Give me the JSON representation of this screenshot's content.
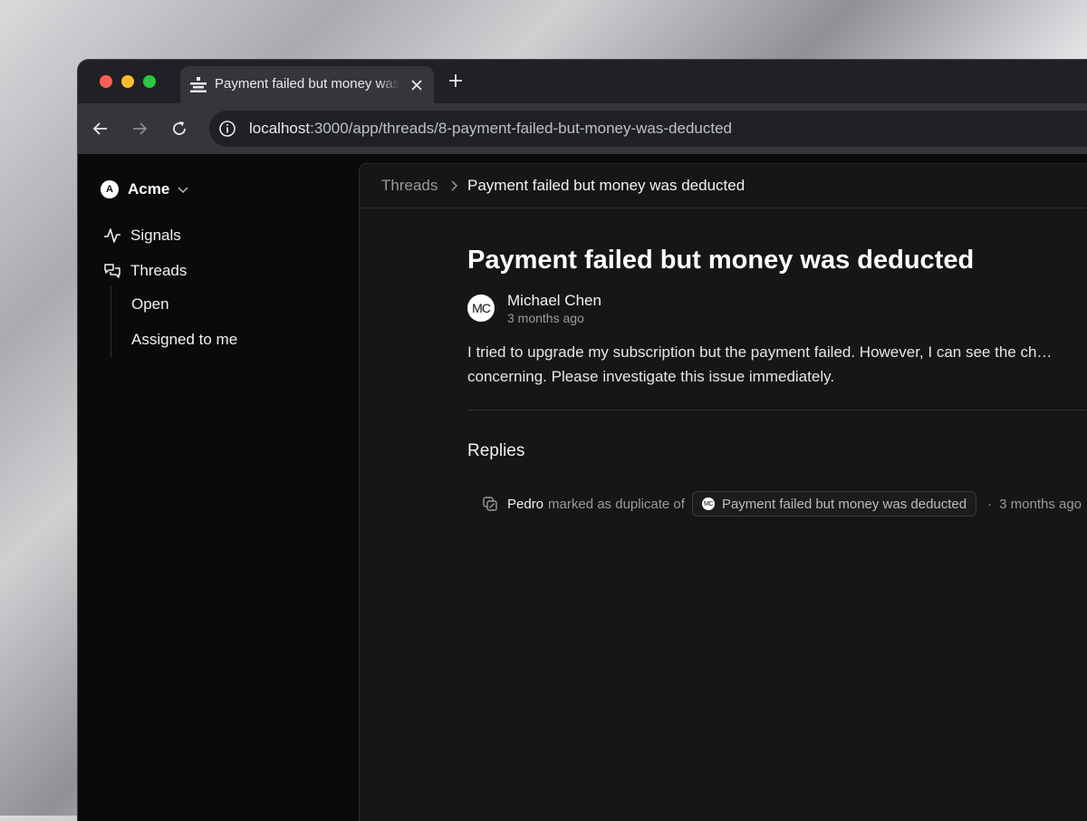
{
  "browser": {
    "tab": {
      "title": "Payment failed but money was deducted",
      "favicon": "app-favicon-icon"
    },
    "address": {
      "host": "localhost",
      "rest": ":3000/app/threads/8-payment-failed-but-money-was-deducted"
    },
    "colors": {
      "close": "#ff5f57",
      "minimize": "#febc2e",
      "maximize": "#28c840"
    }
  },
  "sidebar": {
    "workspace": {
      "initial": "A",
      "name": "Acme"
    },
    "items": [
      {
        "label": "Signals",
        "icon": "activity-icon"
      },
      {
        "label": "Threads",
        "icon": "chat-bubbles-icon"
      }
    ],
    "subitems": [
      {
        "label": "Open"
      },
      {
        "label": "Assigned to me"
      }
    ]
  },
  "breadcrumb": {
    "root": "Threads",
    "current": "Payment failed but money was deducted"
  },
  "thread": {
    "title": "Payment failed but money was deducted",
    "author": {
      "initials": "MC",
      "name": "Michael Chen",
      "time": "3 months ago"
    },
    "body": "I tried to upgrade my subscription but the payment failed. However, I can see the ch… concerning. Please investigate this issue immediately."
  },
  "replies": {
    "heading": "Replies",
    "activity": {
      "user": "Pedro",
      "action": "marked as duplicate of",
      "ref_initials": "MC",
      "ref_title": "Payment failed but money was deducted",
      "separator": "·",
      "time": "3 months ago"
    }
  }
}
